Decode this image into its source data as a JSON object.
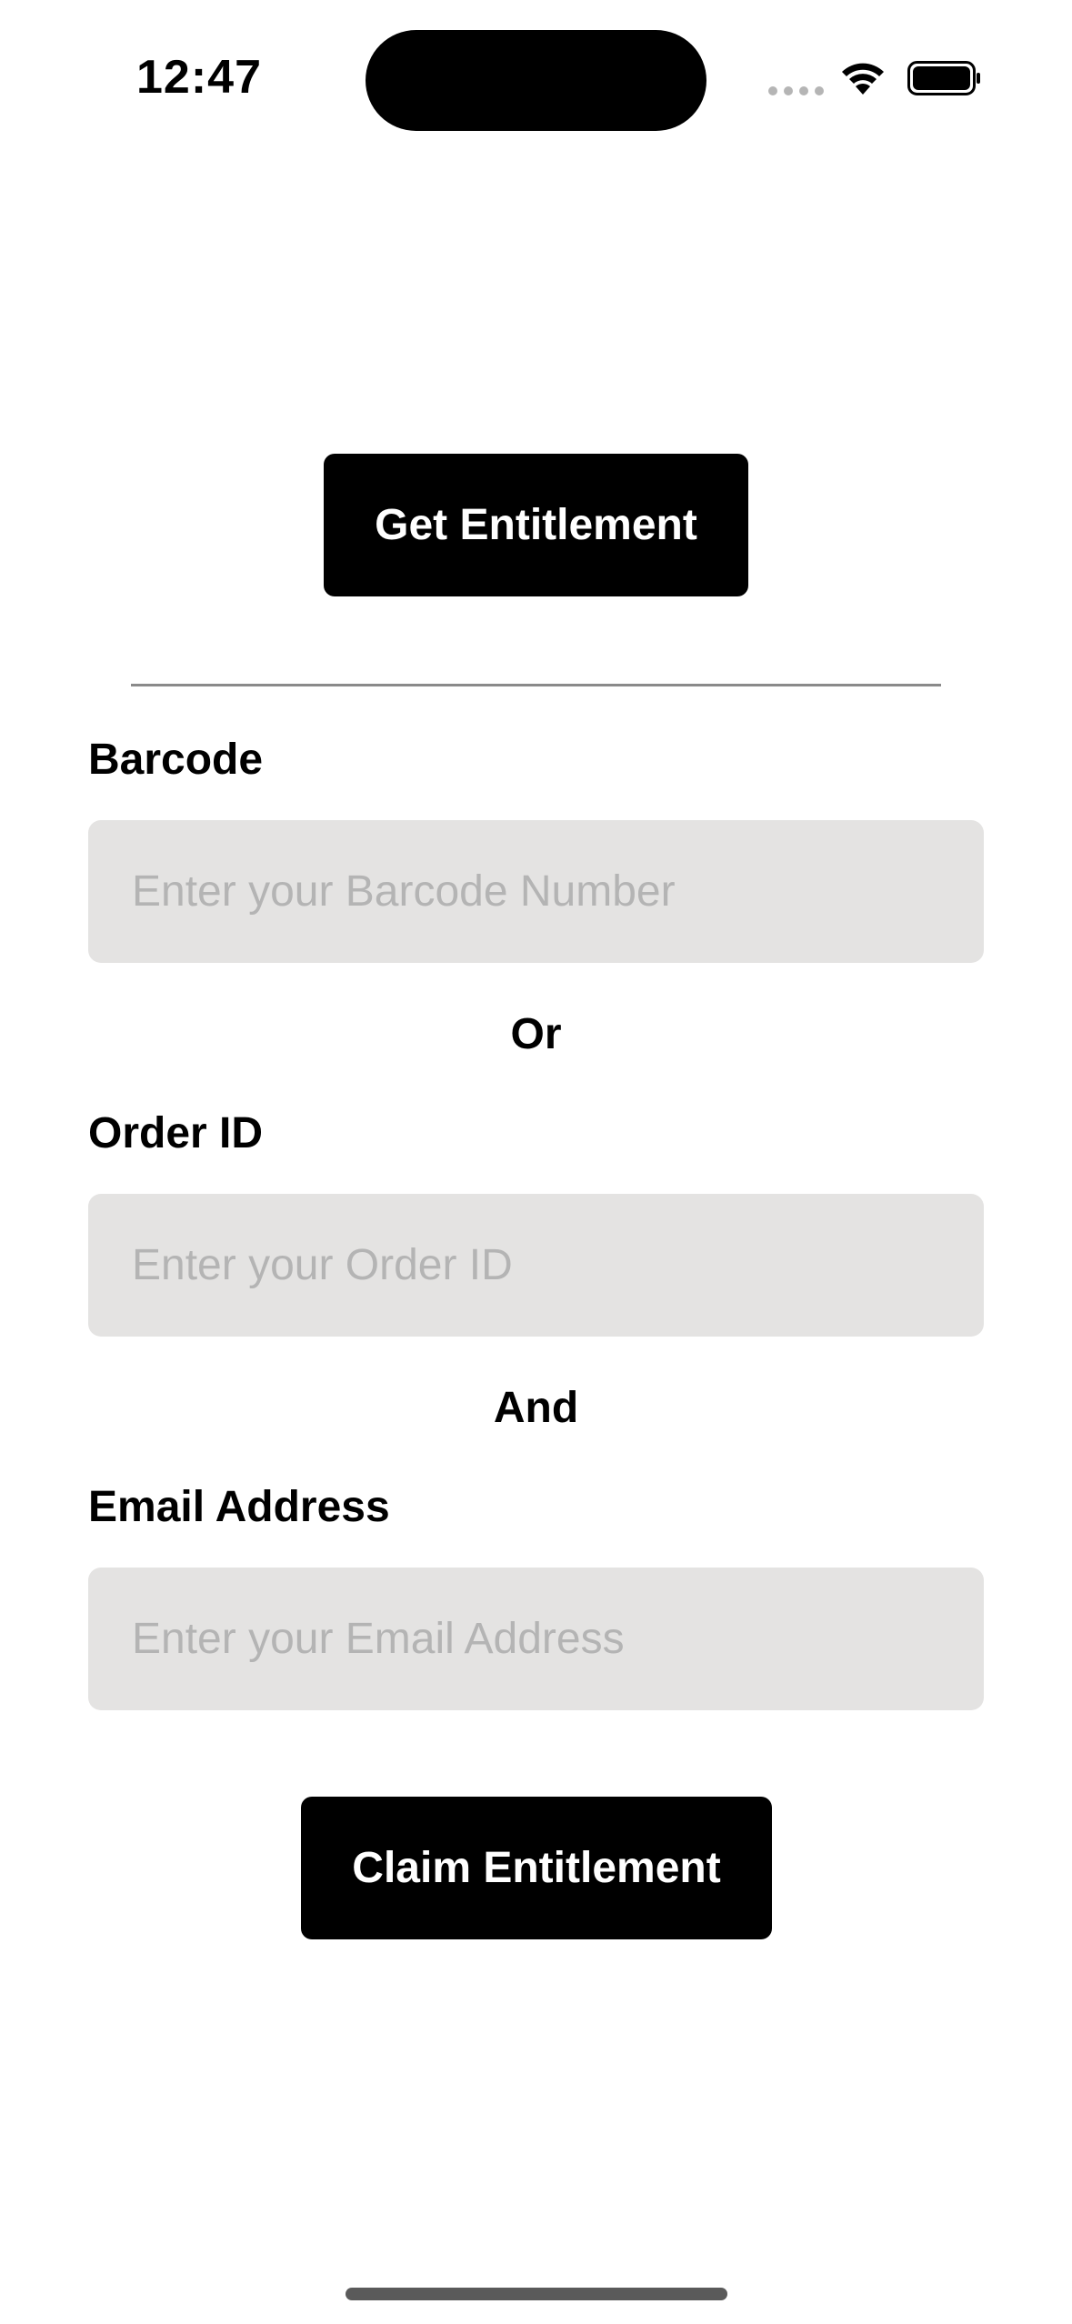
{
  "status_bar": {
    "time": "12:47",
    "wifi_icon": "wifi-icon",
    "battery_icon": "battery-icon",
    "signal_icon": "cellular-dots-icon"
  },
  "actions": {
    "get_entitlement_label": "Get Entitlement",
    "claim_entitlement_label": "Claim Entitlement"
  },
  "form": {
    "barcode": {
      "label": "Barcode",
      "placeholder": "Enter your Barcode Number",
      "value": ""
    },
    "or_text": "Or",
    "order_id": {
      "label": "Order ID",
      "placeholder": "Enter your Order ID",
      "value": ""
    },
    "and_text": "And",
    "email": {
      "label": "Email Address",
      "placeholder": "Enter your Email Address",
      "value": ""
    }
  },
  "colors": {
    "button_bg": "#000000",
    "button_text": "#ffffff",
    "input_bg": "#e4e3e2",
    "placeholder": "#b4b4b4",
    "divider": "#8a8a8a"
  }
}
